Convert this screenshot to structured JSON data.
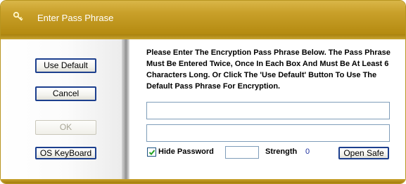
{
  "window": {
    "title": "Enter Pass Phrase",
    "title_icon": "key-icon"
  },
  "sidebar": {
    "use_default_label": "Use Default",
    "cancel_label": "Cancel",
    "ok_label": "OK",
    "os_keyboard_label": "OS KeyBoard"
  },
  "main": {
    "instructions": "Please Enter The Encryption Pass Phrase Below. The Pass Phrase Must Be Entered Twice, Once In Each Box And Must Be At Least 6 Characters Long. Or Click The 'Use Default' Button To Use The Default Pass Phrase For Encryption.",
    "pass_phrase_value": "",
    "confirm_pass_phrase_value": "",
    "hide_password_label": "Hide Password",
    "hide_password_checked": true,
    "strength_box_value": "",
    "strength_label": "Strength",
    "strength_value": "0",
    "open_safe_label": "Open Safe"
  },
  "colors": {
    "title_bar": "#c9a02a",
    "button_border": "#1c3f8e",
    "strength_value": "#1c2f9e"
  }
}
